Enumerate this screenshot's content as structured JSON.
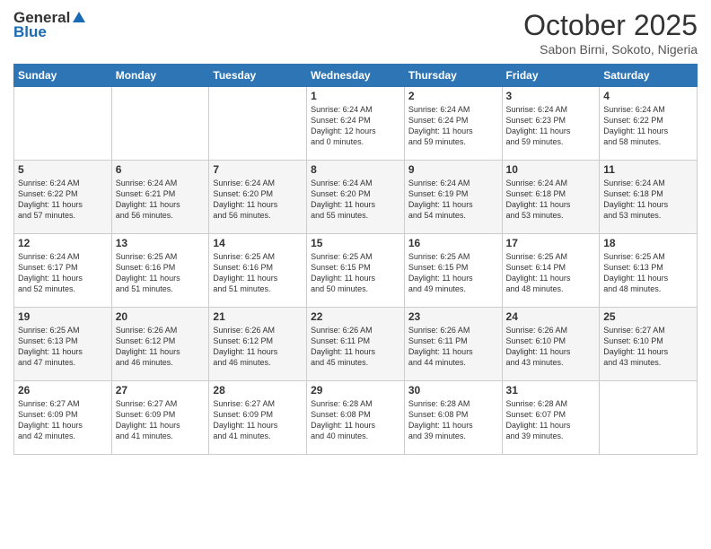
{
  "header": {
    "logo_general": "General",
    "logo_blue": "Blue",
    "title": "October 2025",
    "location": "Sabon Birni, Sokoto, Nigeria"
  },
  "weekdays": [
    "Sunday",
    "Monday",
    "Tuesday",
    "Wednesday",
    "Thursday",
    "Friday",
    "Saturday"
  ],
  "weeks": [
    [
      {
        "day": "",
        "info": ""
      },
      {
        "day": "",
        "info": ""
      },
      {
        "day": "",
        "info": ""
      },
      {
        "day": "1",
        "info": "Sunrise: 6:24 AM\nSunset: 6:24 PM\nDaylight: 12 hours\nand 0 minutes."
      },
      {
        "day": "2",
        "info": "Sunrise: 6:24 AM\nSunset: 6:24 PM\nDaylight: 11 hours\nand 59 minutes."
      },
      {
        "day": "3",
        "info": "Sunrise: 6:24 AM\nSunset: 6:23 PM\nDaylight: 11 hours\nand 59 minutes."
      },
      {
        "day": "4",
        "info": "Sunrise: 6:24 AM\nSunset: 6:22 PM\nDaylight: 11 hours\nand 58 minutes."
      }
    ],
    [
      {
        "day": "5",
        "info": "Sunrise: 6:24 AM\nSunset: 6:22 PM\nDaylight: 11 hours\nand 57 minutes."
      },
      {
        "day": "6",
        "info": "Sunrise: 6:24 AM\nSunset: 6:21 PM\nDaylight: 11 hours\nand 56 minutes."
      },
      {
        "day": "7",
        "info": "Sunrise: 6:24 AM\nSunset: 6:20 PM\nDaylight: 11 hours\nand 56 minutes."
      },
      {
        "day": "8",
        "info": "Sunrise: 6:24 AM\nSunset: 6:20 PM\nDaylight: 11 hours\nand 55 minutes."
      },
      {
        "day": "9",
        "info": "Sunrise: 6:24 AM\nSunset: 6:19 PM\nDaylight: 11 hours\nand 54 minutes."
      },
      {
        "day": "10",
        "info": "Sunrise: 6:24 AM\nSunset: 6:18 PM\nDaylight: 11 hours\nand 53 minutes."
      },
      {
        "day": "11",
        "info": "Sunrise: 6:24 AM\nSunset: 6:18 PM\nDaylight: 11 hours\nand 53 minutes."
      }
    ],
    [
      {
        "day": "12",
        "info": "Sunrise: 6:24 AM\nSunset: 6:17 PM\nDaylight: 11 hours\nand 52 minutes."
      },
      {
        "day": "13",
        "info": "Sunrise: 6:25 AM\nSunset: 6:16 PM\nDaylight: 11 hours\nand 51 minutes."
      },
      {
        "day": "14",
        "info": "Sunrise: 6:25 AM\nSunset: 6:16 PM\nDaylight: 11 hours\nand 51 minutes."
      },
      {
        "day": "15",
        "info": "Sunrise: 6:25 AM\nSunset: 6:15 PM\nDaylight: 11 hours\nand 50 minutes."
      },
      {
        "day": "16",
        "info": "Sunrise: 6:25 AM\nSunset: 6:15 PM\nDaylight: 11 hours\nand 49 minutes."
      },
      {
        "day": "17",
        "info": "Sunrise: 6:25 AM\nSunset: 6:14 PM\nDaylight: 11 hours\nand 48 minutes."
      },
      {
        "day": "18",
        "info": "Sunrise: 6:25 AM\nSunset: 6:13 PM\nDaylight: 11 hours\nand 48 minutes."
      }
    ],
    [
      {
        "day": "19",
        "info": "Sunrise: 6:25 AM\nSunset: 6:13 PM\nDaylight: 11 hours\nand 47 minutes."
      },
      {
        "day": "20",
        "info": "Sunrise: 6:26 AM\nSunset: 6:12 PM\nDaylight: 11 hours\nand 46 minutes."
      },
      {
        "day": "21",
        "info": "Sunrise: 6:26 AM\nSunset: 6:12 PM\nDaylight: 11 hours\nand 46 minutes."
      },
      {
        "day": "22",
        "info": "Sunrise: 6:26 AM\nSunset: 6:11 PM\nDaylight: 11 hours\nand 45 minutes."
      },
      {
        "day": "23",
        "info": "Sunrise: 6:26 AM\nSunset: 6:11 PM\nDaylight: 11 hours\nand 44 minutes."
      },
      {
        "day": "24",
        "info": "Sunrise: 6:26 AM\nSunset: 6:10 PM\nDaylight: 11 hours\nand 43 minutes."
      },
      {
        "day": "25",
        "info": "Sunrise: 6:27 AM\nSunset: 6:10 PM\nDaylight: 11 hours\nand 43 minutes."
      }
    ],
    [
      {
        "day": "26",
        "info": "Sunrise: 6:27 AM\nSunset: 6:09 PM\nDaylight: 11 hours\nand 42 minutes."
      },
      {
        "day": "27",
        "info": "Sunrise: 6:27 AM\nSunset: 6:09 PM\nDaylight: 11 hours\nand 41 minutes."
      },
      {
        "day": "28",
        "info": "Sunrise: 6:27 AM\nSunset: 6:09 PM\nDaylight: 11 hours\nand 41 minutes."
      },
      {
        "day": "29",
        "info": "Sunrise: 6:28 AM\nSunset: 6:08 PM\nDaylight: 11 hours\nand 40 minutes."
      },
      {
        "day": "30",
        "info": "Sunrise: 6:28 AM\nSunset: 6:08 PM\nDaylight: 11 hours\nand 39 minutes."
      },
      {
        "day": "31",
        "info": "Sunrise: 6:28 AM\nSunset: 6:07 PM\nDaylight: 11 hours\nand 39 minutes."
      },
      {
        "day": "",
        "info": ""
      }
    ]
  ]
}
